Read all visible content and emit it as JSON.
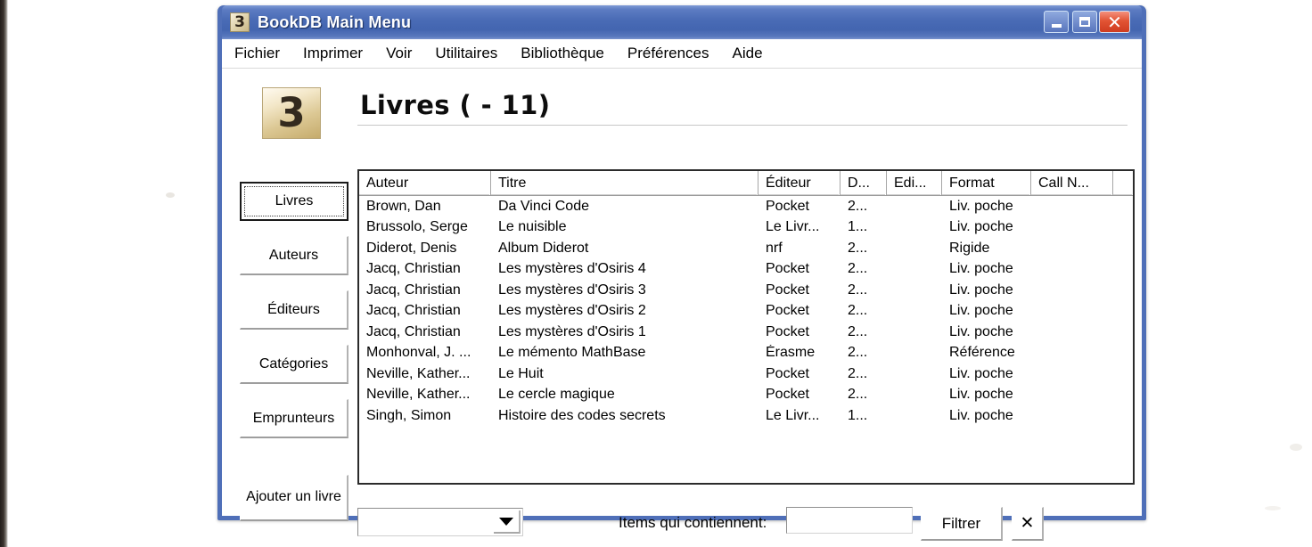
{
  "window": {
    "title": "BookDB Main Menu",
    "logo_text": "3",
    "controls": {
      "minimize": "minimize-button",
      "maximize": "maximize-button",
      "close": "✕"
    },
    "colors": {
      "title_bar": "#4f6fb8",
      "close_button": "#e25434",
      "logo_background": "#ddd0a8",
      "client_background": "#ffffff"
    }
  },
  "menu": {
    "items": [
      {
        "label": "Fichier"
      },
      {
        "label": "Imprimer"
      },
      {
        "label": "Voir"
      },
      {
        "label": "Utilitaires"
      },
      {
        "label": "Bibliothèque"
      },
      {
        "label": "Préférences"
      },
      {
        "label": "Aide"
      }
    ]
  },
  "header": {
    "logo_text": "3",
    "page_title": "Livres ( - 11)"
  },
  "sidebar": {
    "items": [
      {
        "label": "Livres",
        "focused": true
      },
      {
        "label": "Auteurs",
        "focused": false
      },
      {
        "label": "Éditeurs",
        "focused": false
      },
      {
        "label": "Catégories",
        "focused": false
      },
      {
        "label": "Emprunteurs",
        "focused": false
      }
    ],
    "add_button": {
      "label": "Ajouter un livre"
    }
  },
  "table": {
    "columns": [
      {
        "label": "Auteur"
      },
      {
        "label": "Titre"
      },
      {
        "label": "Éditeur"
      },
      {
        "label": "D..."
      },
      {
        "label": "Edi..."
      },
      {
        "label": "Format"
      },
      {
        "label": "Call N..."
      }
    ],
    "rows": [
      {
        "auteur": "Brown, Dan",
        "titre": "Da Vinci Code",
        "editeur": "Pocket",
        "d": "2...",
        "edi": "",
        "format": "Liv. poche",
        "call_n": ""
      },
      {
        "auteur": "Brussolo, Serge",
        "titre": "Le nuisible",
        "editeur": "Le Livr...",
        "d": "1...",
        "edi": "",
        "format": "Liv. poche",
        "call_n": ""
      },
      {
        "auteur": "Diderot, Denis",
        "titre": "Album Diderot",
        "editeur": "nrf",
        "d": "2...",
        "edi": "",
        "format": "Rigide",
        "call_n": ""
      },
      {
        "auteur": "Jacq, Christian",
        "titre": "Les mystères d'Osiris 4",
        "editeur": "Pocket",
        "d": "2...",
        "edi": "",
        "format": "Liv. poche",
        "call_n": ""
      },
      {
        "auteur": "Jacq, Christian",
        "titre": "Les mystères d'Osiris 3",
        "editeur": "Pocket",
        "d": "2...",
        "edi": "",
        "format": "Liv. poche",
        "call_n": ""
      },
      {
        "auteur": "Jacq, Christian",
        "titre": "Les mystères d'Osiris 2",
        "editeur": "Pocket",
        "d": "2...",
        "edi": "",
        "format": "Liv. poche",
        "call_n": ""
      },
      {
        "auteur": "Jacq, Christian",
        "titre": "Les mystères d'Osiris 1",
        "editeur": "Pocket",
        "d": "2...",
        "edi": "",
        "format": "Liv. poche",
        "call_n": ""
      },
      {
        "auteur": "Monhonval, J. ...",
        "titre": "Le mémento MathBase",
        "editeur": "Érasme",
        "d": "2...",
        "edi": "",
        "format": "Référence",
        "call_n": ""
      },
      {
        "auteur": "Neville, Kather...",
        "titre": "Le Huit",
        "editeur": "Pocket",
        "d": "2...",
        "edi": "",
        "format": "Liv. poche",
        "call_n": ""
      },
      {
        "auteur": "Neville, Kather...",
        "titre": "Le cercle magique",
        "editeur": "Pocket",
        "d": "2...",
        "edi": "",
        "format": "Liv. poche",
        "call_n": ""
      },
      {
        "auteur": "Singh, Simon",
        "titre": "Histoire des codes secrets",
        "editeur": "Le Livr...",
        "d": "1...",
        "edi": "",
        "format": "Liv. poche",
        "call_n": ""
      }
    ]
  },
  "footer": {
    "combo_value": "",
    "combo_arrow": "chevron-down-icon",
    "filter_label": "Items qui contiennent:",
    "filter_value": "",
    "filter_placeholder": "",
    "filter_button": "Filtrer",
    "clear_button": "✕"
  }
}
